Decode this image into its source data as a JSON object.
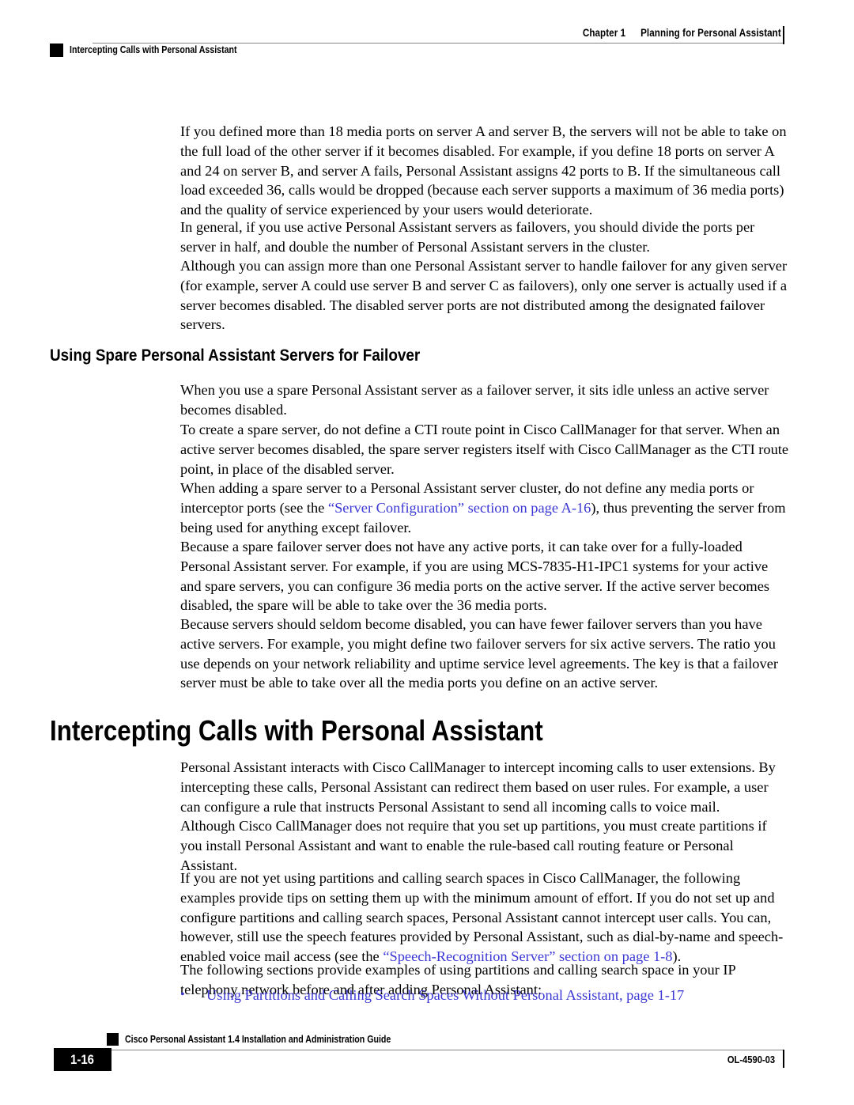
{
  "header": {
    "chapter_number": "Chapter 1",
    "chapter_title": "Planning for Personal Assistant",
    "running_section": "Intercepting Calls with Personal Assistant"
  },
  "body": {
    "paragraphs": [
      {
        "id": "p1",
        "text": "If you defined more than 18 media ports on server A and server B, the servers will not be able to take on the full load of the other server if it becomes disabled. For example, if you define 18 ports on server A and 24 on server B, and server A fails, Personal Assistant assigns 42 ports to B. If the simultaneous call load exceeded 36, calls would be dropped (because each server supports a maximum of 36 media ports) and the quality of service experienced by your users would deteriorate."
      },
      {
        "id": "p2",
        "text": "In general, if you use active Personal Assistant servers as failovers, you should divide the ports per server in half, and double the number of Personal Assistant servers in the cluster."
      },
      {
        "id": "p3",
        "text": "Although you can assign more than one Personal Assistant server to handle failover for any given server (for example, server A could use server B and server C as failovers), only one server is actually used if a server becomes disabled. The disabled server ports are not distributed among the designated failover servers."
      },
      {
        "id": "p4",
        "text": "When you use a spare Personal Assistant server as a failover server, it sits idle unless an active server becomes disabled."
      },
      {
        "id": "p5",
        "text": "To create a spare server, do not define a CTI route point in Cisco CallManager for that server. When an active server becomes disabled, the spare server registers itself with Cisco CallManager as the CTI route point, in place of the disabled server."
      },
      {
        "id": "p6a",
        "text": "When adding a spare server to a Personal Assistant server cluster, do not define any media ports or interceptor ports (see the "
      },
      {
        "id": "p6link",
        "text": "“Server Configuration” section on page A-16"
      },
      {
        "id": "p6b",
        "text": "), thus preventing the server from being used for anything except failover."
      },
      {
        "id": "p7",
        "text": "Because a spare failover server does not have any active ports, it can take over for a fully-loaded Personal Assistant server. For example, if you are using MCS-7835-H1-IPC1 systems for your active and spare servers, you can configure 36 media ports on the active server. If the active server becomes disabled, the spare will be able to take over the 36 media ports."
      },
      {
        "id": "p8",
        "text": "Because servers should seldom become disabled, you can have fewer failover servers than you have active servers. For example, you might define two failover servers for six active servers. The ratio you use depends on your network reliability and uptime service level agreements. The key is that a failover server must be able to take over all the media ports you define on an active server."
      },
      {
        "id": "p9",
        "text": "Personal Assistant interacts with Cisco CallManager to intercept incoming calls to user extensions. By intercepting these calls, Personal Assistant can redirect them based on user rules. For example, a user can configure a rule that instructs Personal Assistant to send all incoming calls to voice mail."
      },
      {
        "id": "p10",
        "text": "Although Cisco CallManager does not require that you set up partitions, you must create partitions if you install Personal Assistant and want to enable the rule-based call routing feature or Personal Assistant."
      },
      {
        "id": "p11a",
        "text": "If you are not yet using partitions and calling search spaces in Cisco CallManager, the following examples provide tips on setting them up with the minimum amount of effort. If you do not set up and configure partitions and calling search spaces, Personal Assistant cannot intercept user calls. You can, however, still use the speech features provided by Personal Assistant, such as dial-by-name and speech-enabled voice mail access (see the "
      },
      {
        "id": "p11link",
        "text": "“Speech-Recognition Server” section on page 1-8"
      },
      {
        "id": "p11b",
        "text": ")."
      },
      {
        "id": "p12",
        "text": "The following sections provide examples of using partitions and calling search space in your IP telephony network before and after adding Personal Assistant:"
      }
    ],
    "headings": {
      "h2_spare_servers": "Using Spare Personal Assistant Servers for Failover",
      "h1_intercepting": "Intercepting Calls with Personal Assistant"
    },
    "bullets": [
      {
        "marker": "•",
        "text": "Using Partitions and Calling Search Spaces Without Personal Assistant, page 1-17"
      }
    ]
  },
  "footer": {
    "guide_title": "Cisco Personal Assistant 1.4 Installation and Administration Guide",
    "page_number": "1-16",
    "doc_id": "OL-4590-03"
  },
  "colors": {
    "link": "#3b37d4",
    "rule": "#848484",
    "text": "#000000",
    "background": "#ffffff"
  }
}
